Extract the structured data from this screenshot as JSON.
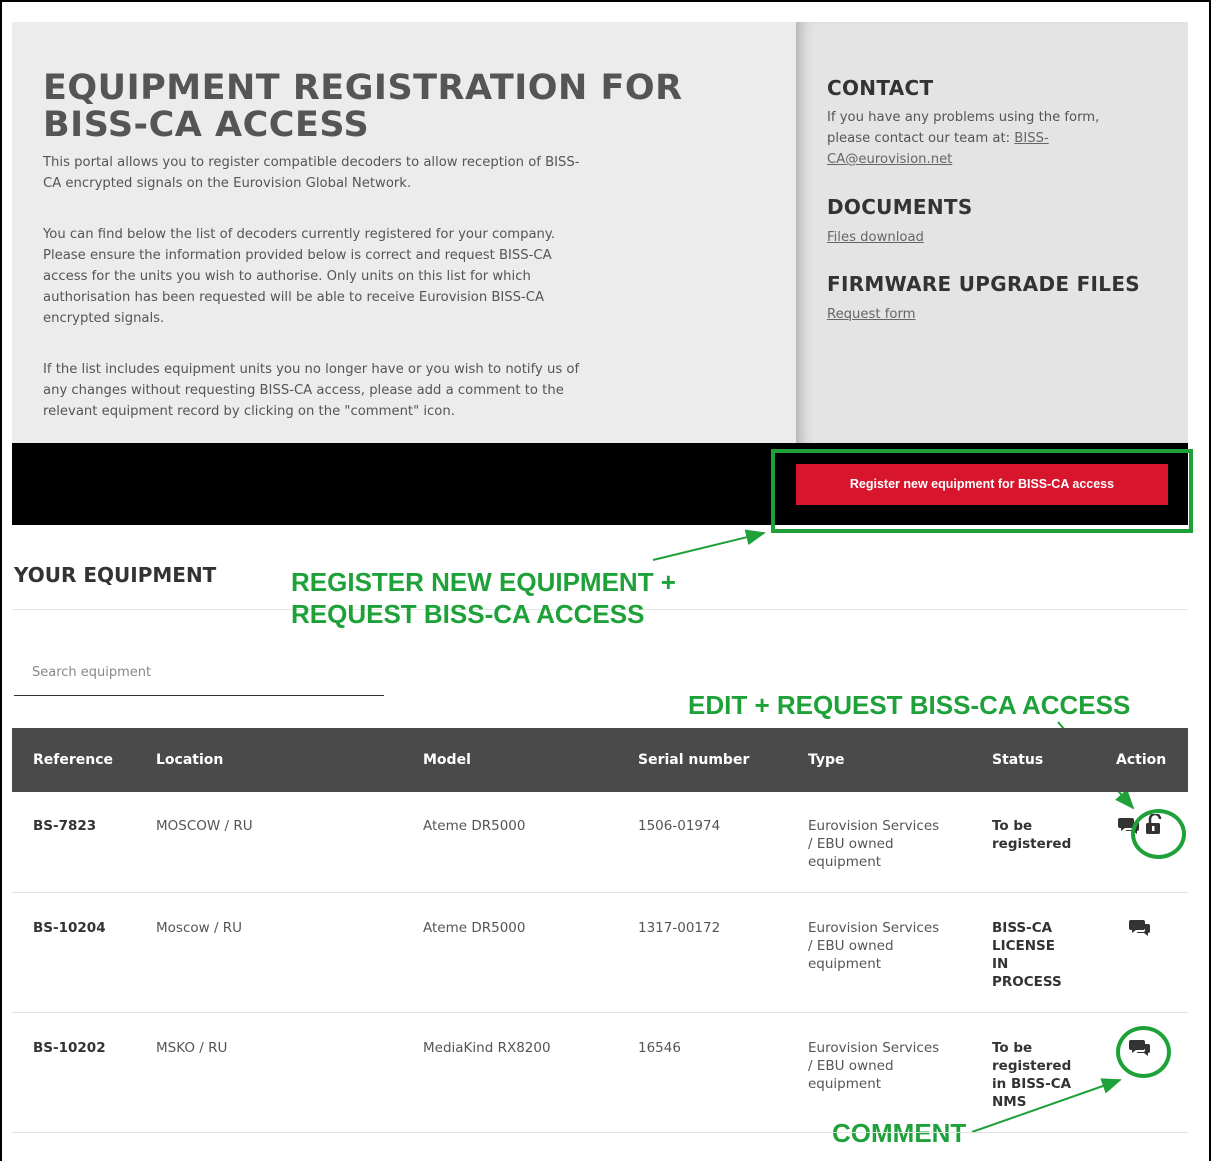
{
  "hero": {
    "title_line1": "EQUIPMENT REGISTRATION FOR",
    "title_line2": "BISS-CA ACCESS",
    "intro_1": "This portal allows you to register compatible decoders to allow reception of BISS-",
    "intro_2": "CA encrypted signals on the Eurovision Global Network.",
    "p2_1": "You can find below the list of decoders currently registered for your company.",
    "p2_2": "Please ensure the information provided below is correct and request BISS-CA",
    "p2_3": "access for the units you wish to authorise. Only units on this list for which",
    "p2_4": "authorisation has been requested will be able to receive Eurovision BISS-CA",
    "p2_5": "encrypted signals.",
    "p3_1": "If the list includes equipment units you no longer have or you wish to notify us of",
    "p3_2": "any changes without requesting BISS-CA access, please add a comment to the",
    "p3_3": "relevant equipment record by clicking on the \"comment\" icon."
  },
  "sidebar": {
    "contact_title": "CONTACT",
    "contact_1": "If you have any problems using the form,",
    "contact_2": "please contact our team at: ",
    "contact_link_1": "BISS-",
    "contact_link_2": "CA@eurovision.net",
    "documents_title": "DOCUMENTS",
    "documents_link": "Files download",
    "firmware_title": "FIRMWARE UPGRADE FILES",
    "firmware_link": "Request form"
  },
  "register_button": "Register new equipment for BISS-CA access",
  "section_title": "YOUR EQUIPMENT",
  "search": {
    "placeholder": "Search equipment"
  },
  "annotations": {
    "register_1": "REGISTER NEW EQUIPMENT +",
    "register_2": "REQUEST BISS-CA ACCESS",
    "edit": "EDIT + REQUEST BISS-CA ACCESS",
    "comment": "COMMENT"
  },
  "table": {
    "headers": {
      "reference": "Reference",
      "location": "Location",
      "model": "Model",
      "serial": "Serial number",
      "type": "Type",
      "status": "Status",
      "action": "Action"
    },
    "rows": [
      {
        "reference": "BS-7823",
        "location": "MOSCOW / RU",
        "model": "Ateme DR5000",
        "serial": "1506-01974",
        "type_1": "Eurovision Services",
        "type_2": "/ EBU owned",
        "type_3": "equipment",
        "status_1": "To be",
        "status_2": "registered",
        "status_3": "",
        "status_4": ""
      },
      {
        "reference": "BS-10204",
        "location": "Moscow / RU",
        "model": "Ateme DR5000",
        "serial": "1317-00172",
        "type_1": "Eurovision Services",
        "type_2": "/ EBU owned",
        "type_3": "equipment",
        "status_1": "BISS-CA",
        "status_2": "LICENSE",
        "status_3": "IN",
        "status_4": "PROCESS"
      },
      {
        "reference": "BS-10202",
        "location": "MSKO / RU",
        "model": "MediaKind RX8200",
        "serial": "16546",
        "type_1": "Eurovision Services",
        "type_2": "/ EBU owned",
        "type_3": "equipment",
        "status_1": "To be",
        "status_2": "registered",
        "status_3": "in BISS-CA",
        "status_4": "NMS"
      }
    ]
  },
  "colors": {
    "accent_red": "#d7152d",
    "annotation_green": "#1fa13a",
    "table_header": "#4a4a4a"
  }
}
